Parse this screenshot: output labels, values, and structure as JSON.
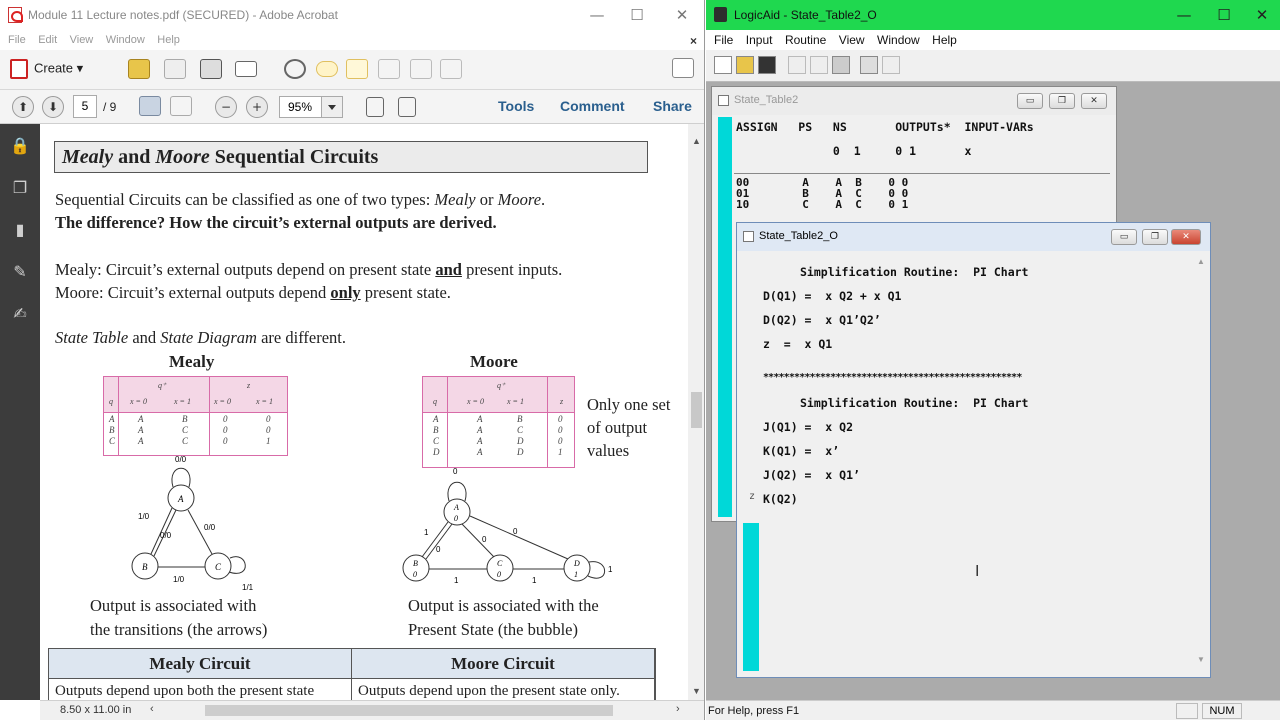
{
  "acrobat": {
    "title": "Module 11 Lecture notes.pdf (SECURED) - Adobe Acrobat",
    "menu": [
      "File",
      "Edit",
      "View",
      "Window",
      "Help"
    ],
    "close_doc": "×",
    "create_label": "Create",
    "page_current": "5",
    "page_total": "/ 9",
    "zoom": "95%",
    "nav": {
      "tools": "Tools",
      "comment": "Comment",
      "share": "Share"
    },
    "status_size": "8.50 x 11.00 in"
  },
  "doc": {
    "heading_a": "Mealy",
    "heading_b": " and ",
    "heading_c": "Moore",
    "heading_d": " Sequential Circuits",
    "intro_1": "Sequential Circuits can be classified as one of two types: ",
    "intro_mealy": "Mealy",
    "intro_or": " or ",
    "intro_moore": "Moore",
    "intro_end": ".",
    "intro_2": "The difference? How the circuit’s external outputs are derived.",
    "mealy_1": "Mealy: Circuit’s external outputs depend on present state ",
    "mealy_and": "and",
    "mealy_2": " present inputs.",
    "moore_1": "Moore: Circuit’s external outputs depend ",
    "moore_only": "only",
    "moore_2": " present state.",
    "st_a": "State Table",
    "st_b": " and ",
    "st_c": "State Diagram",
    "st_d": " are different.",
    "mealy_label": "Mealy",
    "moore_label": "Moore",
    "only_one_1": "Only one set",
    "only_one_2": "of output",
    "only_one_3": "values",
    "mealy_note_1": "Output is associated with",
    "mealy_note_2": "the transitions (the arrows)",
    "moore_note_1": "Output is associated with the",
    "moore_note_2": "Present State (the bubble)",
    "table_h1": "Mealy Circuit",
    "table_h2": "Moore Circuit",
    "table_r1": "Outputs depend upon both the present state",
    "table_r2": "Outputs depend upon the present state only.",
    "mealy_table": {
      "head_q": "q",
      "head_qplus": "q⁺",
      "head_z": "z",
      "sub": [
        "x = 0",
        "x = 1",
        "x = 0",
        "x = 1"
      ],
      "rows": [
        [
          "A",
          "A",
          "B",
          "0",
          "0"
        ],
        [
          "B",
          "A",
          "C",
          "0",
          "0"
        ],
        [
          "C",
          "A",
          "C",
          "0",
          "1"
        ]
      ]
    },
    "moore_table": {
      "head_q": "q",
      "head_qplus": "q⁺",
      "head_z": "z",
      "sub": [
        "x = 0",
        "x = 1"
      ],
      "rows": [
        [
          "A",
          "A",
          "B",
          "0"
        ],
        [
          "B",
          "A",
          "C",
          "0"
        ],
        [
          "C",
          "A",
          "D",
          "0"
        ],
        [
          "D",
          "A",
          "D",
          "1"
        ]
      ]
    },
    "mealy_diagram": {
      "states": [
        "A",
        "B",
        "C"
      ],
      "labels": [
        "0/0",
        "1/0",
        "0/0",
        "0/0",
        "1/0",
        "1/1"
      ]
    },
    "moore_diagram": {
      "states": [
        "A",
        "B",
        "C",
        "D"
      ],
      "outputs": [
        "0",
        "0",
        "0",
        "1"
      ],
      "labels": [
        "0",
        "1",
        "0",
        "1",
        "0",
        "1",
        "0",
        "1"
      ]
    }
  },
  "logicaid": {
    "title": "LogicAid - State_Table2_O",
    "menu": [
      "File",
      "Input",
      "Routine",
      "View",
      "Window",
      "Help"
    ],
    "status_help": "For Help, press F1",
    "status_num": "NUM",
    "win1": {
      "title": "State_Table2",
      "header": "ASSIGN   PS   NS       OUTPUTs*  INPUT-VARs",
      "header2": "              0  1     0 1       x",
      "rows": [
        "00        A    A  B    0 0",
        "01        B    A  C    0 0",
        "10        C    A  C    0 1"
      ]
    },
    "win2": {
      "title": "State_Table2_O",
      "lines": [
        "Simplification Routine:  PI Chart",
        "D(Q1) =  x Q2 + x Q1",
        "D(Q2) =  x Q1’Q2’",
        "z  =  x Q1",
        "**************************************************",
        "Simplification Routine:  PI Chart",
        "J(Q1) =  x Q2",
        "K(Q1) =  x’",
        "J(Q2) =  x Q1’",
        "K(Q2)"
      ],
      "margin_char": "z"
    }
  }
}
